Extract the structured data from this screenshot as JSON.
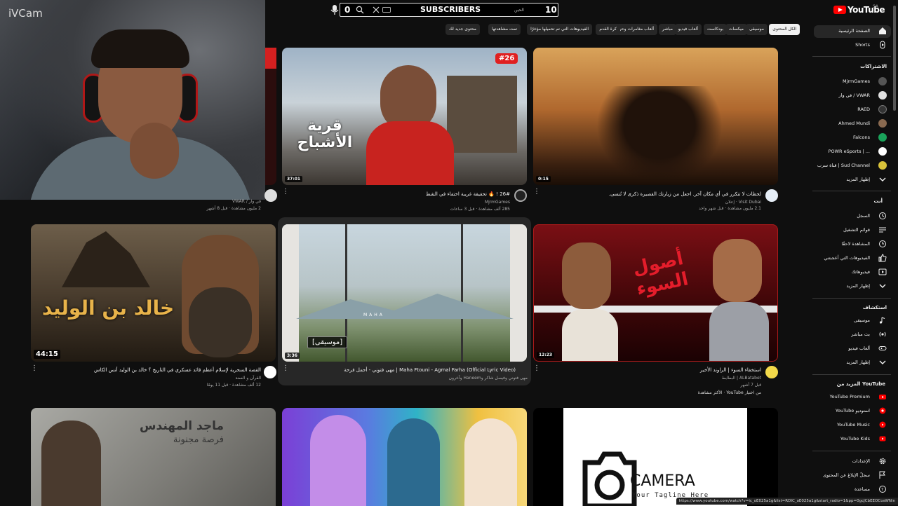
{
  "webcam": {
    "label": "iVCam"
  },
  "topbar": {
    "subscribers_label": "SUBSCRIBERS",
    "left_count": "0",
    "right_count": "10",
    "right_small": "الحين"
  },
  "logo": {
    "text": "YouTube",
    "region": "SA"
  },
  "chips": [
    "الكل المحتوى",
    "موسيقى",
    "ميكسات",
    "بودكاست",
    "ألعاب فيديو",
    "مباشر",
    "ألعاب مغامرات وحركة",
    "كرة القدم",
    "الفيديوهات التي تم تحميلها مؤخرًا",
    "تمت مشاهدتها",
    "محتوى جديد لك"
  ],
  "sidebar": {
    "home": "الصفحة الرئيسية",
    "shorts": "Shorts",
    "subscriptions_heading": "الاشتراكات",
    "subs": [
      "MjrmGames",
      "في وار / VWAR",
      "RAED",
      "Ahmed Mundi",
      "Falcons",
      "POWR eSports | ...",
      "قناة سرب | Sud Channel"
    ],
    "show_more": "إظهار المزيد",
    "you_heading": "أنت",
    "you_items": [
      "السجل",
      "قوائم التشغيل",
      "المشاهدة لاحقًا",
      "الفيديوهات التي أعجبتني",
      "فيديوهاتك",
      "إظهار المزيد"
    ],
    "explore_heading": "استكشاف",
    "explore_items": [
      "موسيقى",
      "بث مباشر",
      "ألعاب فيديو",
      "إظهار المزيد"
    ],
    "more_heading": "المزيد من YouTube",
    "more_items": [
      "YouTube Premium",
      "YouTube استوديو",
      "YouTube Music",
      "YouTube Kids"
    ],
    "bottom_items": [
      "الإعدادات",
      "سجلّ الإبلاغ عن المحتوى",
      "مساعدة"
    ]
  },
  "videos": [
    {
      "title": "لحظات لا تتكرر في أي مكان آخر. اجعل من زيارتك القصيرة ذكرى لا تُنسى.",
      "channel": "Visit Dubai · إعلان",
      "meta": "2.1 مليون مشاهدة · قبل شهر واحد",
      "duration": "0:15"
    },
    {
      "title": "26# ! 🔥 تحقيقة غريبة اختفاء في الشط",
      "channel": "MjrmGames",
      "meta": "285 ألف مشاهدة · قبل 3 ساعات",
      "duration": "37:01",
      "badge": "#26"
    },
    {
      "title": "",
      "channel": "في وار / VWAR",
      "meta": "2 مليون مشاهدة · قبل 8 أشهر",
      "duration": ""
    },
    {
      "title": "استخفاء السوء | الراوند الأخير",
      "channel": "ALBatabet | البطابط",
      "meta": "قبل 7 أشهر",
      "duration": "12:23",
      "extra": "من اختيار YouTube · الأكثر مشاهدة"
    },
    {
      "title": "Maha Ftouni - Agmal Farha (Official Lyric Video) | مهى فتوني - أجمل فرحة",
      "channel": "مهى فتوني وفيصل شاكر وHaneem وآخرون",
      "meta": "",
      "duration": "3:36",
      "tag": "[موسيقى]",
      "thumb_text": "MAHA"
    },
    {
      "title": "القصة السحرية لإسلام أعظم قائد عسكري في التاريخ ؟ خالد بن الوليد   أنس الكاس",
      "channel": "القرآن و السنة",
      "meta": "12 ألف مشاهدة · قبل 11 يومًا",
      "duration": "44:15",
      "thumb_text": "خالد بن الوليد"
    },
    {
      "title": "",
      "channel": "",
      "meta": "",
      "duration": "",
      "thumb_text": "CAMERA",
      "thumb_sub": "Your Tagline Here"
    },
    {
      "title": "",
      "channel": "",
      "meta": "",
      "duration": ""
    },
    {
      "title": "",
      "channel": "",
      "meta": "",
      "duration": "",
      "thumb_text": "ماجد المهندس",
      "thumb_sub": "فرصة مجنونة"
    }
  ],
  "thumb_words": {
    "ghost": "قرية الأشباح",
    "osoul": "أصول السوء"
  },
  "status_url": "https://www.youtube.com/watch?v=ic_oE025a1g&list=RDIC_oE025a1g&start_radio=1&pp=0gcJCbEEOCosWNin"
}
